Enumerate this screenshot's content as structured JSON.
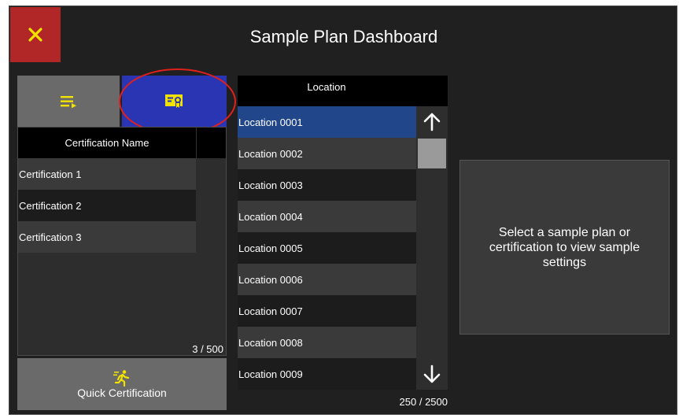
{
  "window": {
    "title": "Sample Plan Dashboard"
  },
  "icons": {
    "close": "close-icon",
    "list": "list-icon",
    "certificate": "certificate-icon",
    "quick": "running-person-icon"
  },
  "colors": {
    "close_bg": "#b12727",
    "selected_tab": "#2a35b4",
    "selected_row": "#21468a",
    "icon_yellow": "#f2e200",
    "highlight_ring": "#e0201c"
  },
  "certifications": {
    "header": "Certification Name",
    "rows": [
      "Certification 1",
      "Certification 2",
      "Certification 3"
    ],
    "count": "3 / 500"
  },
  "quick_certification": {
    "label": "Quick Certification"
  },
  "locations": {
    "header": "Location",
    "rows": [
      "Location 0001",
      "Location 0002",
      "Location 0003",
      "Location 0004",
      "Location 0005",
      "Location 0006",
      "Location 0007",
      "Location 0008",
      "Location 0009"
    ],
    "selected_index": 0,
    "count": "250 / 2500"
  },
  "info": {
    "message": "Select a sample plan or certification to view sample settings"
  }
}
